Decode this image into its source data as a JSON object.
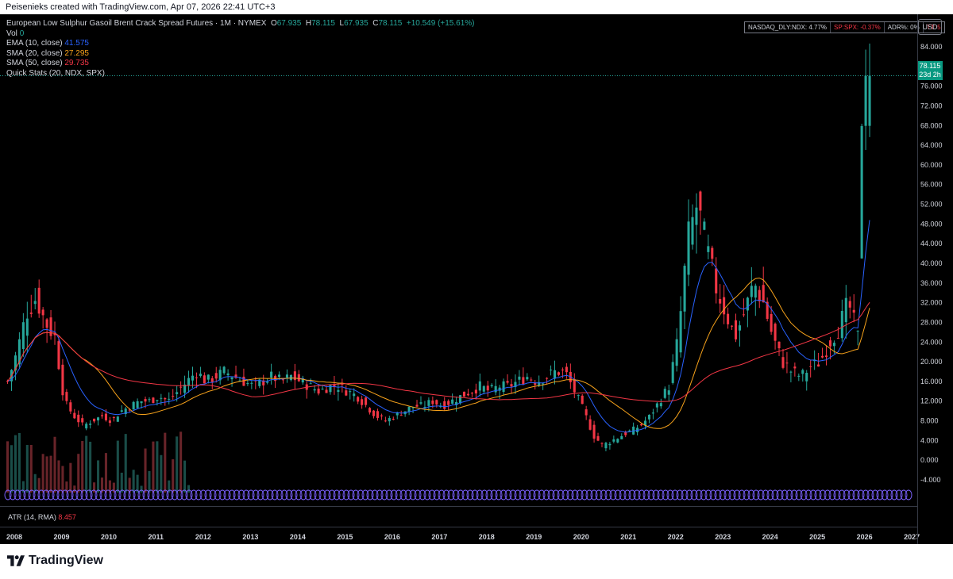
{
  "header": {
    "credit": "Peisenieks created with TradingView.com, Apr 07, 2026 22:41 UTC+3"
  },
  "legend": {
    "title": "European Low Sulphur Gasoil Brent Crack Spread Futures · 1M · NYMEX",
    "o_label": "O",
    "o_value": "67.935",
    "h_label": "H",
    "h_value": "78.115",
    "l_label": "L",
    "l_value": "67.935",
    "c_label": "C",
    "c_value": "78.115",
    "change": "+10.549 (+15.61%)",
    "vol_label": "Vol",
    "vol_value": "0",
    "ema_label": "EMA (10, close)",
    "ema_value": "41.575",
    "sma20_label": "SMA (20, close)",
    "sma20_value": "27.295",
    "sma50_label": "SMA (50, close)",
    "sma50_value": "29.735",
    "quickstats_label": "Quick Stats (20, NDX, SPX)"
  },
  "quick_stats": {
    "ndx": "NASDAQ_DLY:NDX: 4.77%",
    "spx": "SP:SPX: -0.37%",
    "adr": "ADR%: 0%",
    "tt": "TT: 5"
  },
  "currency_button": "USD",
  "last_price": {
    "value": "78.115",
    "countdown": "23d 2h"
  },
  "atr": {
    "label": "ATR (14, RMA)",
    "value": "8.457"
  },
  "brand": {
    "name": "TradingView"
  },
  "colors": {
    "up": "#26a69a",
    "down": "#f23645",
    "ema": "#2962ff",
    "sma20": "#f7a21b",
    "sma50": "#f23645",
    "background": "#000000",
    "tag": "#089981"
  },
  "chart_data": {
    "type": "candlestick",
    "timeframe": "1M",
    "y_ticks": [
      "84.000",
      "80.000",
      "76.000",
      "72.000",
      "68.000",
      "64.000",
      "60.000",
      "56.000",
      "52.000",
      "48.000",
      "44.000",
      "40.000",
      "36.000",
      "32.000",
      "28.000",
      "24.000",
      "20.000",
      "16.000",
      "12.000",
      "8.000",
      "4.000",
      "0.000",
      "-4.000"
    ],
    "x_ticks": [
      "2008",
      "2009",
      "2010",
      "2011",
      "2012",
      "2013",
      "2014",
      "2015",
      "2016",
      "2017",
      "2018",
      "2019",
      "2020",
      "2021",
      "2022",
      "2023",
      "2024",
      "2025",
      "2026",
      "2027"
    ],
    "ylim": [
      -4,
      84
    ],
    "x_range": [
      2008,
      2027.2
    ],
    "approx_closes": [
      [
        2008.0,
        16
      ],
      [
        2008.2,
        22
      ],
      [
        2008.4,
        30
      ],
      [
        2008.6,
        33
      ],
      [
        2008.8,
        28
      ],
      [
        2009.0,
        25
      ],
      [
        2009.2,
        12
      ],
      [
        2009.4,
        9
      ],
      [
        2009.6,
        7
      ],
      [
        2009.8,
        8
      ],
      [
        2010.0,
        9
      ],
      [
        2010.2,
        8
      ],
      [
        2010.4,
        10
      ],
      [
        2010.6,
        11
      ],
      [
        2010.8,
        12
      ],
      [
        2011.0,
        12
      ],
      [
        2011.2,
        13
      ],
      [
        2011.4,
        12
      ],
      [
        2011.6,
        14
      ],
      [
        2011.8,
        16
      ],
      [
        2012.0,
        18
      ],
      [
        2012.2,
        16
      ],
      [
        2012.4,
        17
      ],
      [
        2012.6,
        18
      ],
      [
        2012.8,
        17
      ],
      [
        2013.0,
        16
      ],
      [
        2013.2,
        15
      ],
      [
        2013.4,
        16
      ],
      [
        2013.6,
        17
      ],
      [
        2013.8,
        16
      ],
      [
        2014.0,
        17
      ],
      [
        2014.2,
        16
      ],
      [
        2014.4,
        15
      ],
      [
        2014.6,
        14
      ],
      [
        2014.8,
        15
      ],
      [
        2015.0,
        15
      ],
      [
        2015.2,
        14
      ],
      [
        2015.4,
        13
      ],
      [
        2015.6,
        11
      ],
      [
        2015.8,
        9
      ],
      [
        2016.0,
        8
      ],
      [
        2016.2,
        9
      ],
      [
        2016.4,
        10
      ],
      [
        2016.6,
        11
      ],
      [
        2016.8,
        11
      ],
      [
        2017.0,
        12
      ],
      [
        2017.2,
        11
      ],
      [
        2017.4,
        12
      ],
      [
        2017.6,
        13
      ],
      [
        2017.8,
        14
      ],
      [
        2018.0,
        15
      ],
      [
        2018.2,
        14
      ],
      [
        2018.4,
        15
      ],
      [
        2018.6,
        15
      ],
      [
        2018.8,
        16
      ],
      [
        2019.0,
        17
      ],
      [
        2019.2,
        16
      ],
      [
        2019.4,
        17
      ],
      [
        2019.6,
        18
      ],
      [
        2019.8,
        18
      ],
      [
        2020.0,
        14
      ],
      [
        2020.2,
        10
      ],
      [
        2020.4,
        5
      ],
      [
        2020.6,
        3
      ],
      [
        2020.8,
        4
      ],
      [
        2021.0,
        5
      ],
      [
        2021.2,
        6
      ],
      [
        2021.4,
        7
      ],
      [
        2021.6,
        9
      ],
      [
        2021.8,
        12
      ],
      [
        2022.0,
        15
      ],
      [
        2022.2,
        25
      ],
      [
        2022.4,
        45
      ],
      [
        2022.6,
        52
      ],
      [
        2022.8,
        43
      ],
      [
        2023.0,
        35
      ],
      [
        2023.2,
        30
      ],
      [
        2023.4,
        25
      ],
      [
        2023.6,
        30
      ],
      [
        2023.8,
        36
      ],
      [
        2024.0,
        32
      ],
      [
        2024.2,
        25
      ],
      [
        2024.4,
        20
      ],
      [
        2024.6,
        18
      ],
      [
        2024.8,
        17
      ],
      [
        2025.0,
        19
      ],
      [
        2025.2,
        20
      ],
      [
        2025.4,
        24
      ],
      [
        2025.6,
        27
      ],
      [
        2025.8,
        32
      ],
      [
        2026.0,
        25
      ],
      [
        2026.1,
        40
      ],
      [
        2026.2,
        68
      ],
      [
        2026.3,
        78.1
      ]
    ]
  }
}
